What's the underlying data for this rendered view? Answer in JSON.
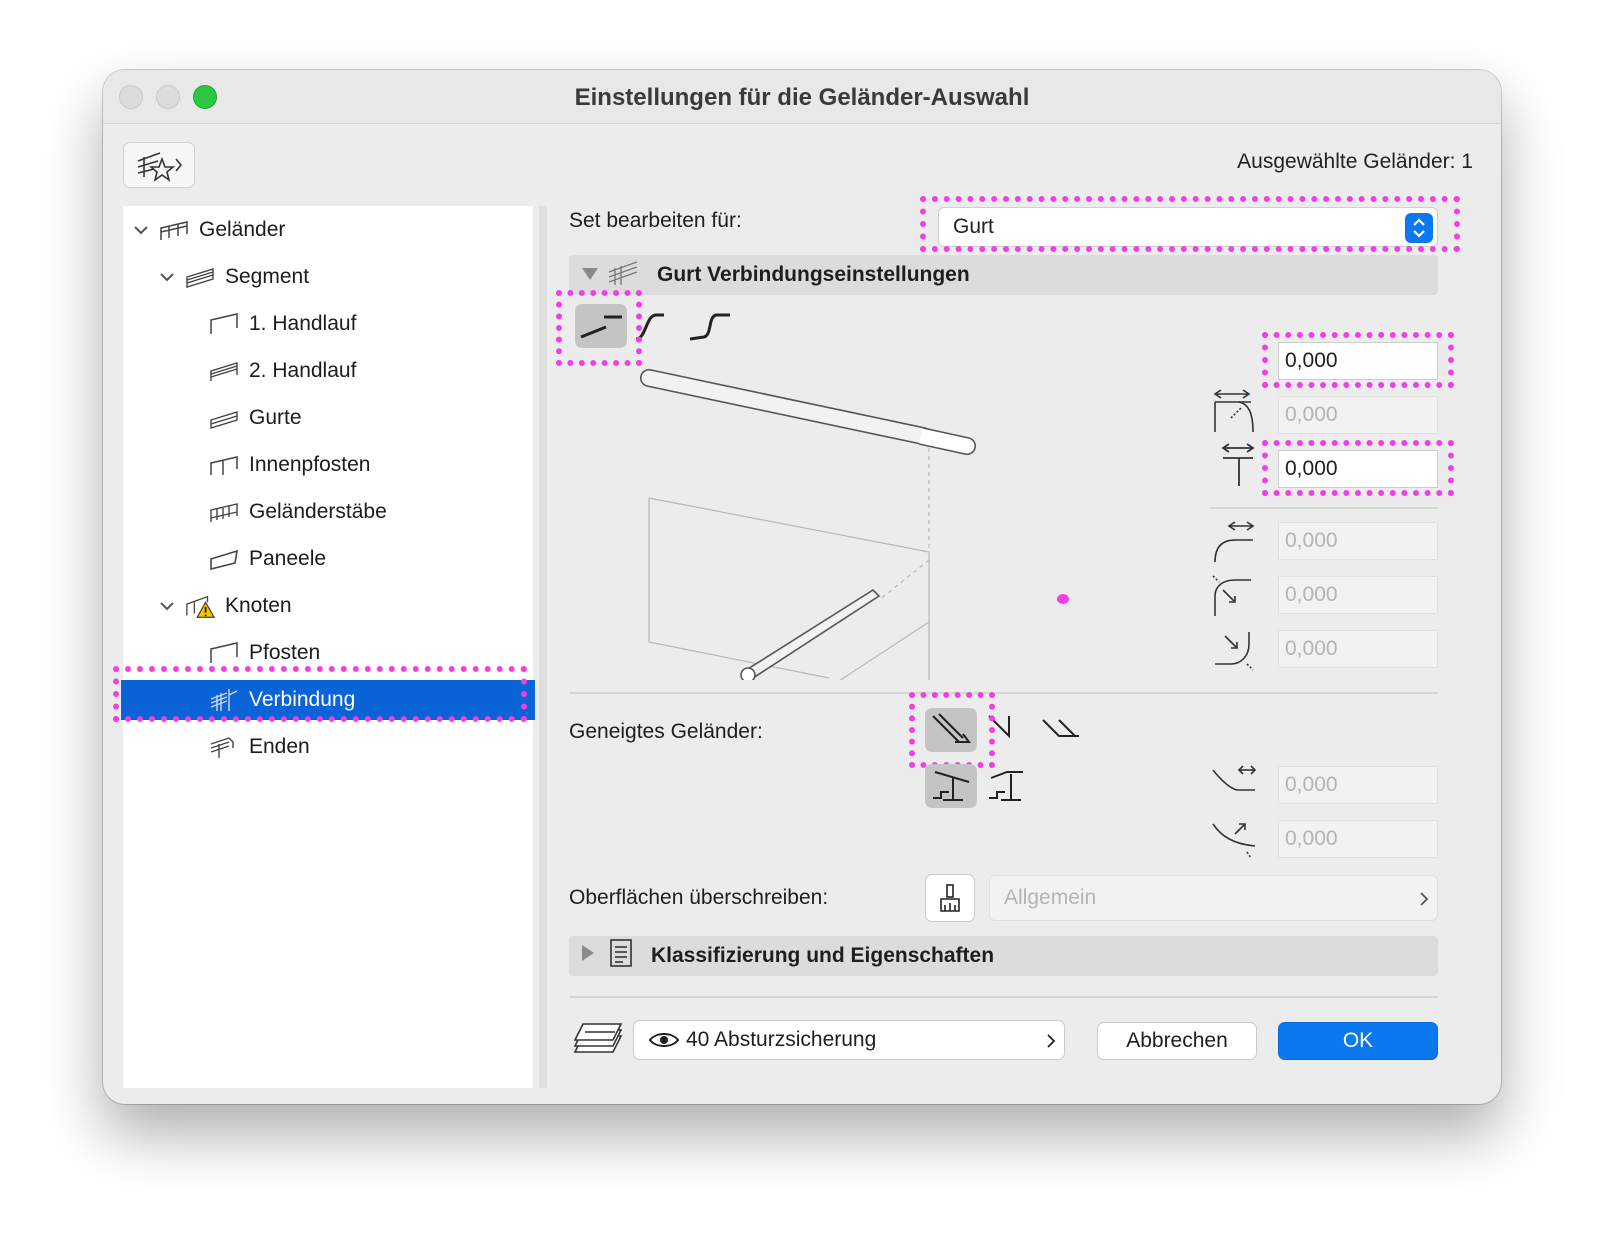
{
  "window": {
    "title": "Einstellungen für die Geländer-Auswahl"
  },
  "header": {
    "selected_count": "Ausgewählte Geländer: 1"
  },
  "tree": {
    "items": [
      {
        "label": "Geländer",
        "level": 0,
        "expanded": true
      },
      {
        "label": "Segment",
        "level": 1,
        "expanded": true
      },
      {
        "label": "1. Handlauf",
        "level": 2
      },
      {
        "label": "2. Handlauf",
        "level": 2
      },
      {
        "label": "Gurte",
        "level": 2
      },
      {
        "label": "Innenpfosten",
        "level": 2
      },
      {
        "label": "Geländerstäbe",
        "level": 2
      },
      {
        "label": "Paneele",
        "level": 2
      },
      {
        "label": "Knoten",
        "level": 1,
        "expanded": true,
        "warning": true
      },
      {
        "label": "Pfosten",
        "level": 2
      },
      {
        "label": "Verbindung",
        "level": 2,
        "selected": true
      },
      {
        "label": "Enden",
        "level": 2
      }
    ]
  },
  "main": {
    "set_label": "Set bearbeiten für:",
    "set_value": "Gurt",
    "section_title": "Gurt Verbindungseinstellungen",
    "fields": {
      "top": "0,000",
      "offset1": "0,000",
      "offset2": "0,000",
      "radius1": "0,000",
      "radius2": "0,000",
      "radius3": "0,000"
    },
    "sloped_label": "Geneigtes Geländer:",
    "sloped_fields": {
      "a": "0,000",
      "b": "0,000"
    },
    "surface_label": "Oberflächen überschreiben:",
    "surface_value": "Allgemein",
    "class_section": "Klassifizierung und Eigenschaften"
  },
  "footer": {
    "layer": "40 Absturzsicherung",
    "cancel": "Abbrechen",
    "ok": "OK"
  },
  "colors": {
    "accent": "#0b78f0",
    "selection": "#0b63d8",
    "highlight": "#f23fe3"
  }
}
